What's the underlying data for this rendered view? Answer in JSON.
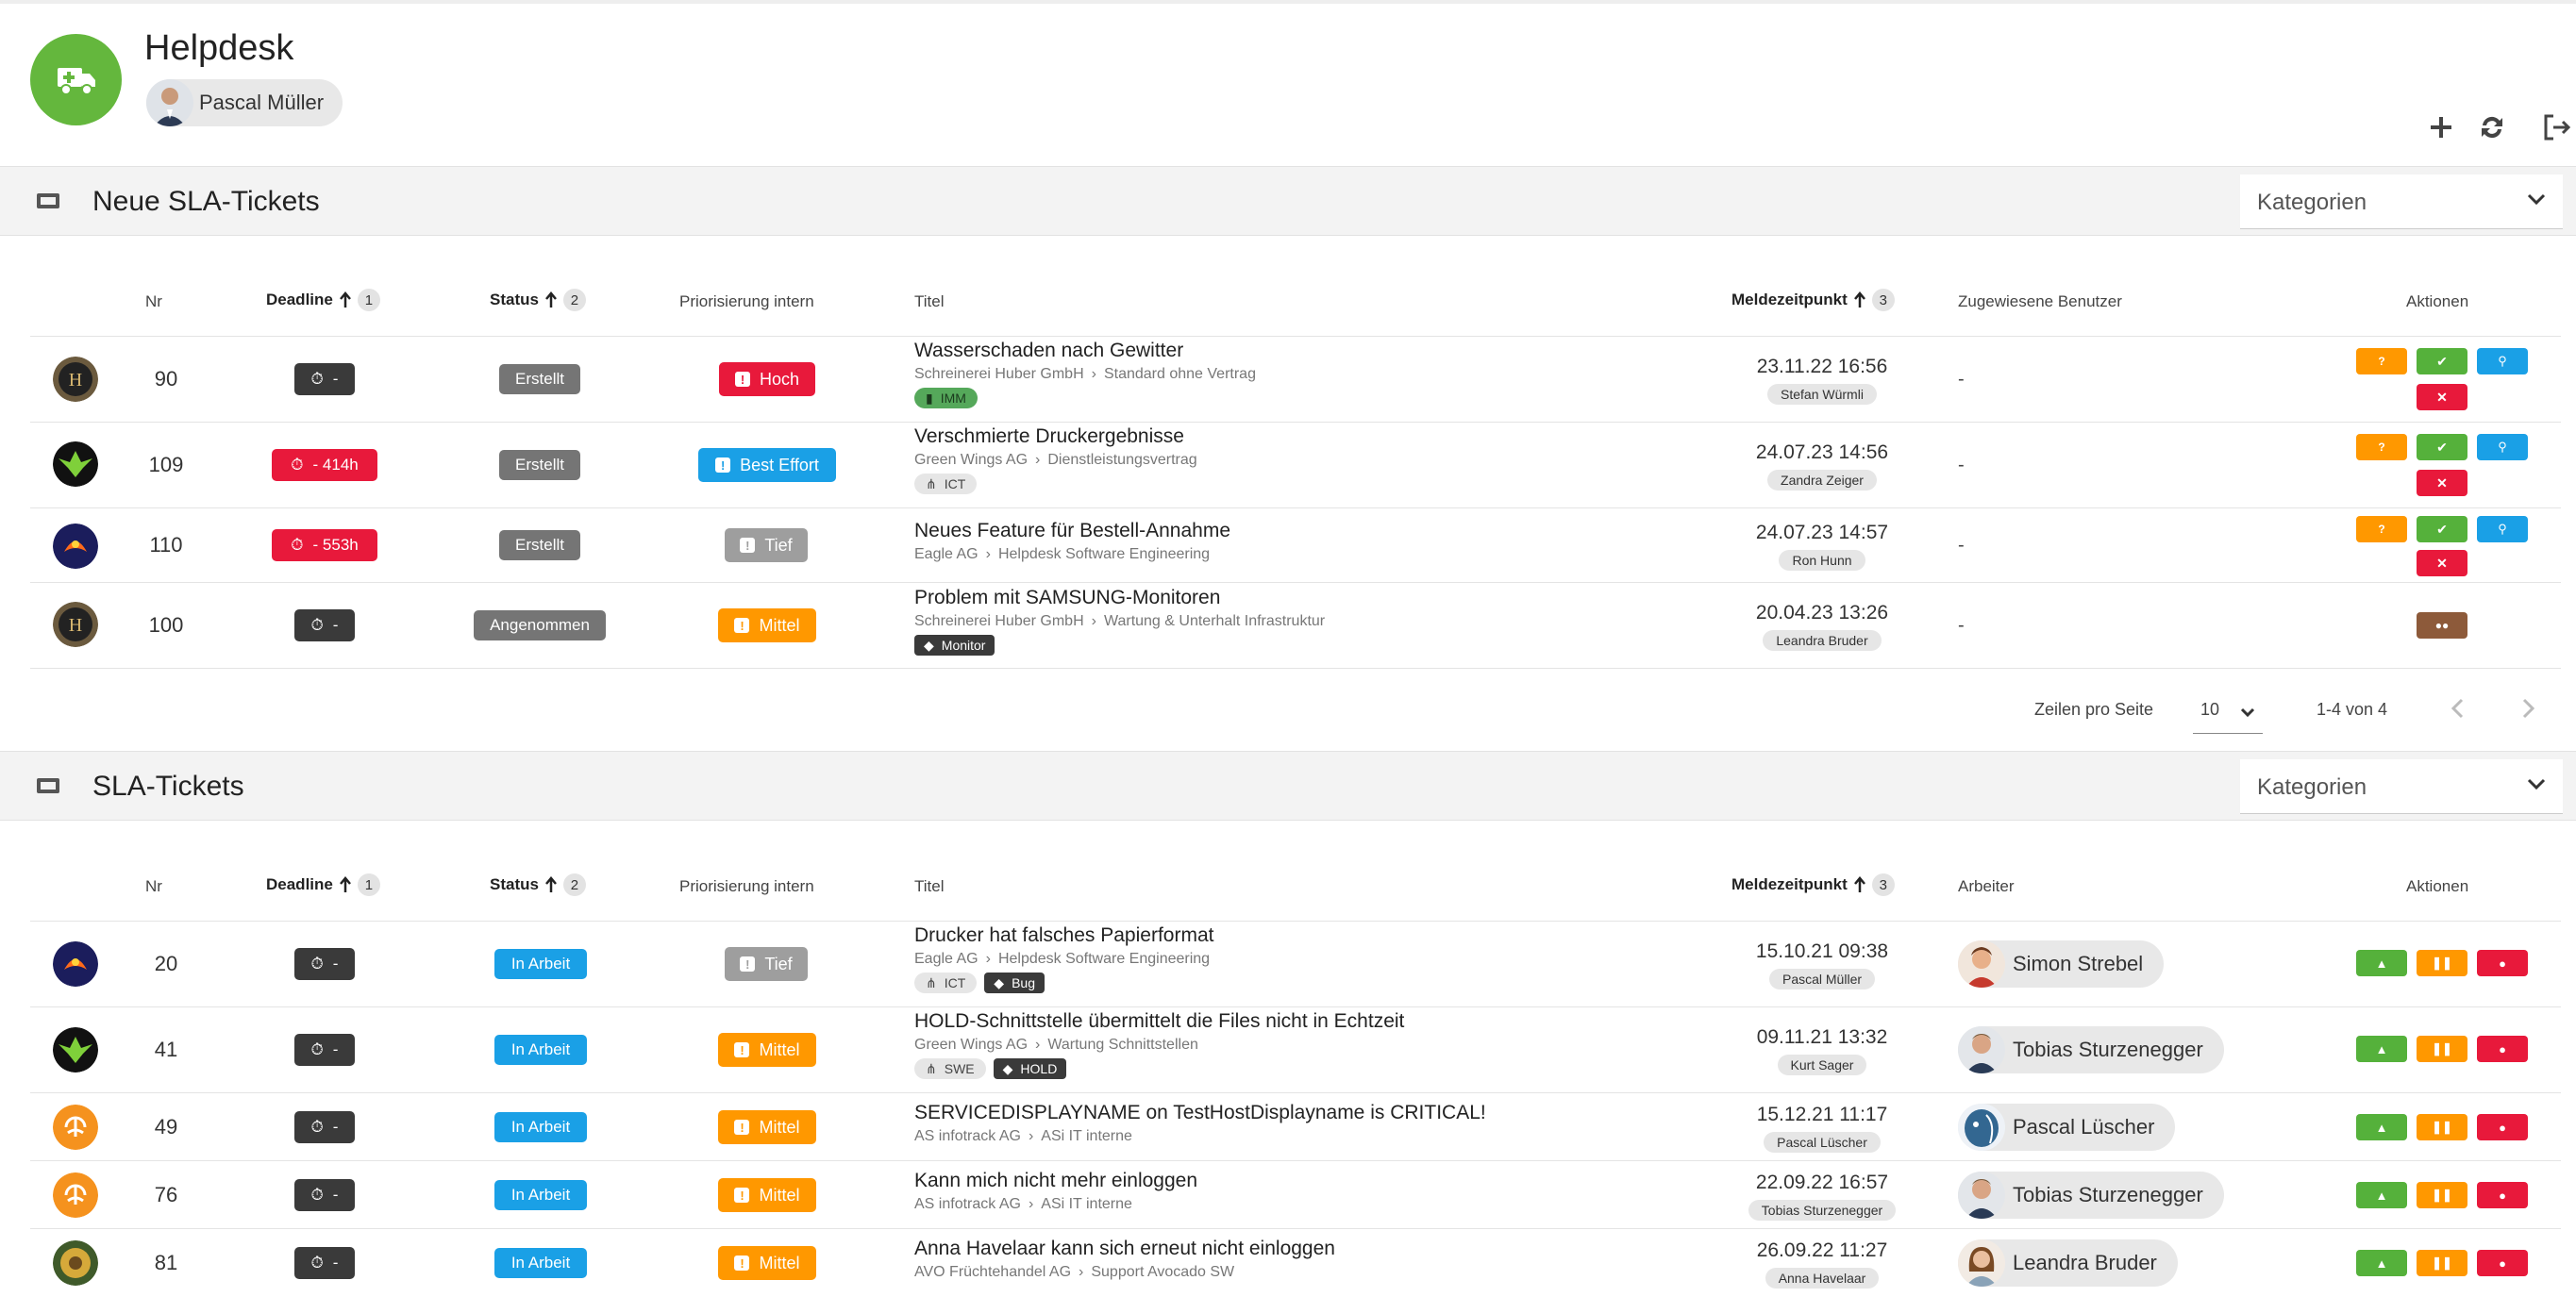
{
  "app": {
    "title": "Helpdesk",
    "user": "Pascal Müller"
  },
  "colors": {
    "brand": "#64b73d",
    "red": "#e8193b",
    "blue": "#1aa0e6",
    "orange": "#ff9800",
    "grey": "#9e9e9e",
    "dark": "#3a3a3a",
    "green": "#55b13b",
    "brown": "#8d5a3a"
  },
  "header_icons": [
    "plus-icon",
    "refresh-icon",
    "logout-icon"
  ],
  "new_section": {
    "title": "Neue SLA-Tickets",
    "category_label": "Kategorien",
    "columns": {
      "nr": "Nr",
      "deadline": "Deadline",
      "deadline_sort": "1",
      "status": "Status",
      "status_sort": "2",
      "priority": "Priorisierung intern",
      "title": "Titel",
      "reported": "Meldezeitpunkt",
      "reported_sort": "3",
      "assigned": "Zugewiesene Benutzer",
      "actions": "Aktionen"
    },
    "rows": [
      {
        "nr": "90",
        "deadline": "-",
        "status": "Erstellt",
        "priority": "Hoch",
        "title": "Wasserschaden nach Gewitter",
        "company": "Schreinerei Huber GmbH",
        "contract": "Standard ohne Vertrag",
        "tag": "IMM",
        "date": "23.11.22 16:56",
        "reporter": "Stefan Würmli",
        "assigned": "-"
      },
      {
        "nr": "109",
        "deadline": "- 414h",
        "status": "Erstellt",
        "priority": "Best Effort",
        "title": "Verschmierte Druckergebnisse",
        "company": "Green Wings AG",
        "contract": "Dienstleistungsvertrag",
        "tag": "ICT",
        "date": "24.07.23 14:56",
        "reporter": "Zandra Zeiger",
        "assigned": "-"
      },
      {
        "nr": "110",
        "deadline": "- 553h",
        "status": "Erstellt",
        "priority": "Tief",
        "title": "Neues Feature für Bestell-Annahme",
        "company": "Eagle AG",
        "contract": "Helpdesk Software Engineering",
        "date": "24.07.23 14:57",
        "reporter": "Ron Hunn",
        "assigned": "-"
      },
      {
        "nr": "100",
        "deadline": "-",
        "status": "Angenommen",
        "priority": "Mittel",
        "title": "Problem mit SAMSUNG-Monitoren",
        "company": "Schreinerei Huber GmbH",
        "contract": "Wartung & Unterhalt Infrastruktur",
        "tag": "Monitor",
        "date": "20.04.23 13:26",
        "reporter": "Leandra Bruder",
        "assigned": "-"
      }
    ],
    "pager": {
      "rows_label": "Zeilen pro Seite",
      "rows_value": "10",
      "range": "1-4 von 4"
    }
  },
  "sla_section": {
    "title": "SLA-Tickets",
    "category_label": "Kategorien",
    "columns": {
      "nr": "Nr",
      "deadline": "Deadline",
      "deadline_sort": "1",
      "status": "Status",
      "status_sort": "2",
      "priority": "Priorisierung intern",
      "title": "Titel",
      "reported": "Meldezeitpunkt",
      "reported_sort": "3",
      "worker": "Arbeiter",
      "actions": "Aktionen"
    },
    "rows": [
      {
        "nr": "20",
        "deadline": "-",
        "status": "In Arbeit",
        "priority": "Tief",
        "title": "Drucker hat falsches Papierformat",
        "company": "Eagle AG",
        "contract": "Helpdesk Software Engineering",
        "tag1": "ICT",
        "tag2": "Bug",
        "date": "15.10.21 09:38",
        "reporter": "Pascal Müller",
        "worker": "Simon Strebel"
      },
      {
        "nr": "41",
        "deadline": "-",
        "status": "In Arbeit",
        "priority": "Mittel",
        "title": "HOLD-Schnittstelle übermittelt die Files nicht in Echtzeit",
        "company": "Green Wings AG",
        "contract": "Wartung Schnittstellen",
        "tag1": "SWE",
        "tag2": "HOLD",
        "date": "09.11.21 13:32",
        "reporter": "Kurt Sager",
        "worker": "Tobias Sturzenegger"
      },
      {
        "nr": "49",
        "deadline": "-",
        "status": "In Arbeit",
        "priority": "Mittel",
        "title": "SERVICEDISPLAYNAME on TestHostDisplayname is CRITICAL!",
        "company": "AS infotrack AG",
        "contract": "ASi IT interne",
        "date": "15.12.21 11:17",
        "reporter": "Pascal Lüscher",
        "worker": "Pascal Lüscher"
      },
      {
        "nr": "76",
        "deadline": "-",
        "status": "In Arbeit",
        "priority": "Mittel",
        "title": "Kann mich nicht mehr einloggen",
        "company": "AS infotrack AG",
        "contract": "ASi IT interne",
        "date": "22.09.22 16:57",
        "reporter": "Tobias Sturzenegger",
        "worker": "Tobias Sturzenegger"
      },
      {
        "nr": "81",
        "deadline": "-",
        "status": "In Arbeit",
        "priority": "Mittel",
        "title": "Anna Havelaar kann sich erneut nicht einloggen",
        "company": "AVO Früchtehandel AG",
        "contract": "Support Avocado SW",
        "date": "26.09.22 11:27",
        "reporter": "Anna Havelaar",
        "worker": "Leandra Bruder"
      }
    ]
  }
}
